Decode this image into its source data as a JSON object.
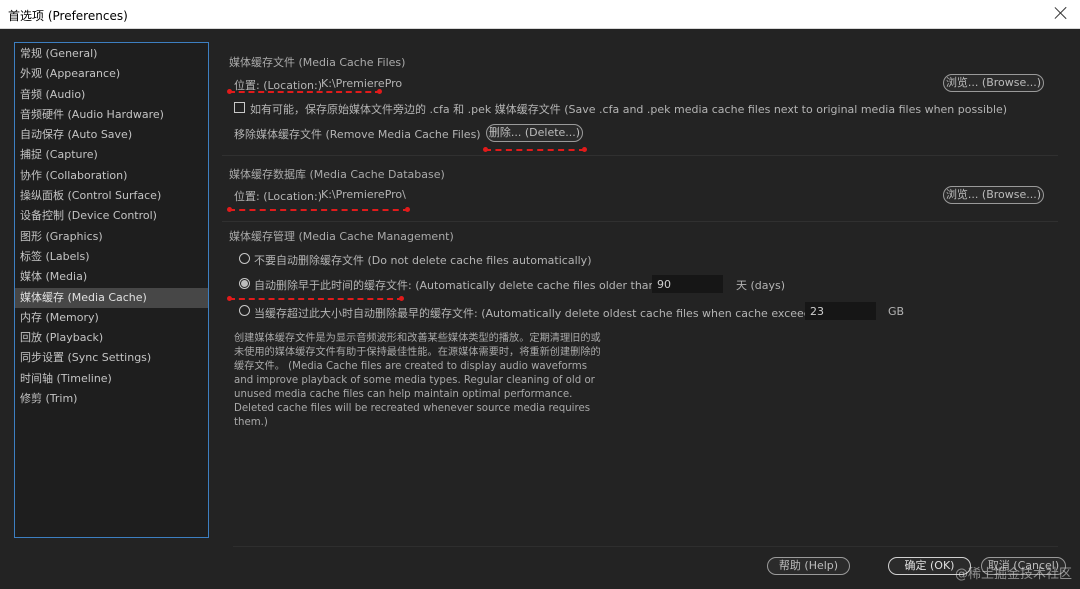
{
  "window": {
    "title": "首选项 (Preferences)"
  },
  "sidebar": {
    "items": [
      {
        "label": "常规 (General)"
      },
      {
        "label": "外观 (Appearance)"
      },
      {
        "label": "音频 (Audio)"
      },
      {
        "label": "音频硬件 (Audio Hardware)"
      },
      {
        "label": "自动保存 (Auto Save)"
      },
      {
        "label": "捕捉 (Capture)"
      },
      {
        "label": "协作 (Collaboration)"
      },
      {
        "label": "操纵面板 (Control Surface)"
      },
      {
        "label": "设备控制 (Device Control)"
      },
      {
        "label": "图形 (Graphics)"
      },
      {
        "label": "标签 (Labels)"
      },
      {
        "label": "媒体 (Media)"
      },
      {
        "label": "媒体缓存 (Media Cache)",
        "selected": true
      },
      {
        "label": "内存 (Memory)"
      },
      {
        "label": "回放 (Playback)"
      },
      {
        "label": "同步设置 (Sync Settings)"
      },
      {
        "label": "时间轴 (Timeline)"
      },
      {
        "label": "修剪 (Trim)"
      }
    ]
  },
  "media_cache_files": {
    "header": "媒体缓存文件 (Media Cache Files)",
    "location_label": "位置: (Location:)",
    "location_value": "K:\\PremierePro",
    "browse_label": "浏览... (Browse...)",
    "checkbox_label": "如有可能，保存原始媒体文件旁边的 .cfa 和 .pek 媒体缓存文件 (Save .cfa and .pek media cache files next to original media files when possible)",
    "checkbox_checked": false,
    "remove_label": "移除媒体缓存文件 (Remove Media Cache Files)",
    "delete_label": "删除... (Delete...)"
  },
  "media_cache_database": {
    "header": "媒体缓存数据库 (Media Cache Database)",
    "location_label": "位置: (Location:)",
    "location_value": "K:\\PremierePro\\",
    "browse_label": "浏览... (Browse...)"
  },
  "media_cache_management": {
    "header": "媒体缓存管理 (Media Cache Management)",
    "option_none": "不要自动删除缓存文件 (Do not delete cache files automatically)",
    "option_older": "自动删除早于此时间的缓存文件: (Automatically delete cache files older than:)",
    "older_value": "90",
    "older_unit": "天 (days)",
    "option_exceeds": "当缓存超过此大小时自动删除最早的缓存文件: (Automatically delete oldest cache files when cache exceeds:)",
    "exceeds_value": "23",
    "exceeds_unit": "GB",
    "selected_option": "older",
    "description": "创建媒体缓存文件是为显示音频波形和改善某些媒体类型的播放。定期清理旧的或未使用的媒体缓存文件有助于保持最佳性能。在源媒体需要时，将重新创建删除的缓存文件。 (Media Cache files are created to display audio waveforms and improve playback of some media types.  Regular cleaning of old or unused media cache files can help maintain optimal performance. Deleted cache files will be recreated whenever source media requires them.)"
  },
  "footer": {
    "help_label": "帮助 (Help)",
    "ok_label": "确定 (OK)",
    "cancel_label": "取消 (Cancel)"
  },
  "watermark": "@稀土掘金技术社区",
  "colors": {
    "annotation": "#e11b1b",
    "selection_border": "#3d7fc1"
  }
}
